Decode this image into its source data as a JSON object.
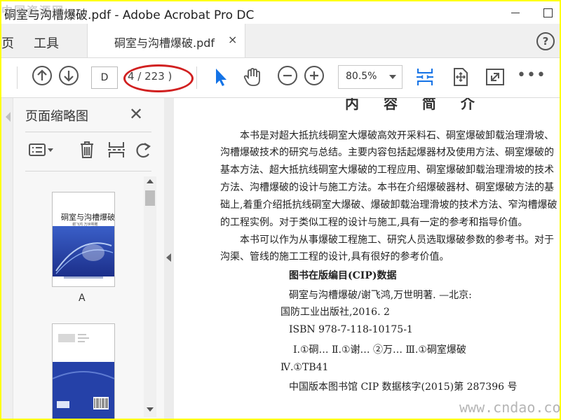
{
  "window": {
    "title": "硐室与沟槽爆破.pdf - Adobe Acrobat Pro DC",
    "watermark_top": "中国资源网"
  },
  "tabs": {
    "partial_left": "页",
    "tools": "工具",
    "document": "硐室与沟槽爆破.pdf",
    "close": "×",
    "help": "?"
  },
  "toolbar": {
    "page_input": "D",
    "page_count": "4 / 223 )",
    "zoom": "80.5%",
    "more": "•••",
    "icons": [
      "prev-page-icon",
      "next-page-icon",
      "select-arrow-icon",
      "hand-tool-icon",
      "zoom-out-icon",
      "zoom-in-icon",
      "scroll-mode-icon",
      "fit-page-icon",
      "fullscreen-icon",
      "more-icon"
    ],
    "highlight_color": "#d12020",
    "accent": "#1473e6"
  },
  "panel": {
    "title": "页面缩略图",
    "close": "✕",
    "thumbnails": [
      {
        "label": "A",
        "cover_title": "硐室与沟槽爆破",
        "cover_authors": "谢飞鸿 万世明著"
      },
      {
        "label": ""
      }
    ]
  },
  "document": {
    "heading": "内 容 简 介",
    "paragraphs": [
      "本书是对超大抵抗线硐室大爆破高效开采料石、硐室爆破卸载治理滑坡、",
      "沟槽爆破技术的研究与总结。主要内容包括起爆器材及使用方法、硐室爆破的",
      "基本方法、超大抵抗线硐室大爆破的工程应用、硐室爆破卸载治理滑坡的技术",
      "方法、沟槽爆破的设计与施工方法。本书在介绍爆破器材、硐室爆破方法的基",
      "础上,着重介绍抵抗线硐室大爆破、爆破卸载治理滑坡的技术方法、窄沟槽爆破",
      "的工程实例。对于类似工程的设计与施工,具有一定的参考和指导价值。",
      "本书可以作为从事爆破工程施工、研究人员选取爆破参数的参考书。对于",
      "沟渠、管线的施工工程的设计,具有很好的参考价值。"
    ],
    "cip_heading": "图书在版编目(CIP)数据",
    "cip_lines": [
      "硐室与沟槽爆破/谢飞鸿,万世明著. —北京:",
      "国防工业出版社,2016. 2",
      "ISBN 978-7-118-10175-1",
      "Ⅰ.①硐…  Ⅱ.①谢… ②万…  Ⅲ.①硐室爆破",
      "Ⅳ.①TB41",
      "中国版本图书馆 CIP 数据核字(2015)第 287396 号"
    ],
    "watermark": "www.cndao.com"
  }
}
